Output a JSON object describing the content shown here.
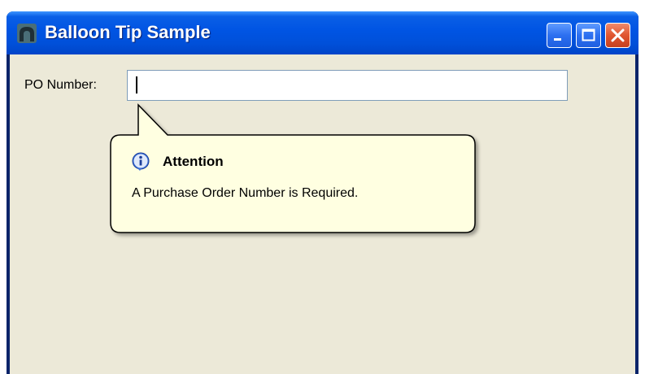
{
  "window": {
    "title": "Balloon Tip Sample",
    "app_icon": "app-arch-icon",
    "caption_buttons": [
      "minimize-icon",
      "maximize-icon",
      "close-icon"
    ]
  },
  "form": {
    "po_label": "PO Number:",
    "po_value": ""
  },
  "balloon": {
    "icon": "info-icon",
    "title": "Attention",
    "message": "A Purchase Order Number is Required."
  },
  "colors": {
    "titlebar": "#0054e3",
    "client_bg": "#ece9d8",
    "balloon_bg": "#ffffe1",
    "close_button": "#e0552f"
  }
}
